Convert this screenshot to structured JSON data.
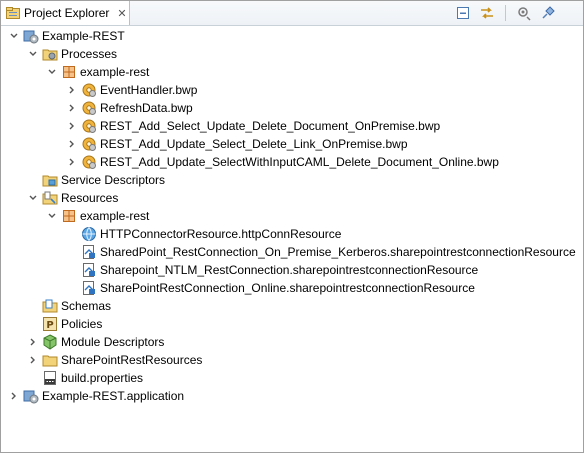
{
  "view": {
    "title": "Project Explorer",
    "close_glyph": "✕",
    "toolbar": [
      "collapse-all-icon",
      "link-with-editor-icon",
      "filters-icon",
      "pin-icon"
    ]
  },
  "tree": {
    "project": "Example-REST",
    "processes": "Processes",
    "processes_folder": "example-rest",
    "processes_items": [
      "EventHandler.bwp",
      "RefreshData.bwp",
      "REST_Add_Select_Update_Delete_Document_OnPremise.bwp",
      "REST_Add_Update_Select_Delete_Link_OnPremise.bwp",
      "REST_Add_Update_SelectWithInputCAML_Delete_Document_Online.bwp"
    ],
    "service_descriptors": "Service Descriptors",
    "resources": "Resources",
    "resources_folder": "example-rest",
    "resources_items": [
      "HTTPConnectorResource.httpConnResource",
      "SharedPoint_RestConnection_On_Premise_Kerberos.sharepointrestconnectionResource",
      "Sharepoint_NTLM_RestConnection.sharepointrestconnectionResource",
      "SharePointRestConnection_Online.sharepointrestconnectionResource"
    ],
    "schemas": "Schemas",
    "policies": "Policies",
    "module_descriptors": "Module Descriptors",
    "sharepoint_rest_resources": "SharePointRestResources",
    "build_properties": "build.properties",
    "application": "Example-REST.application"
  }
}
